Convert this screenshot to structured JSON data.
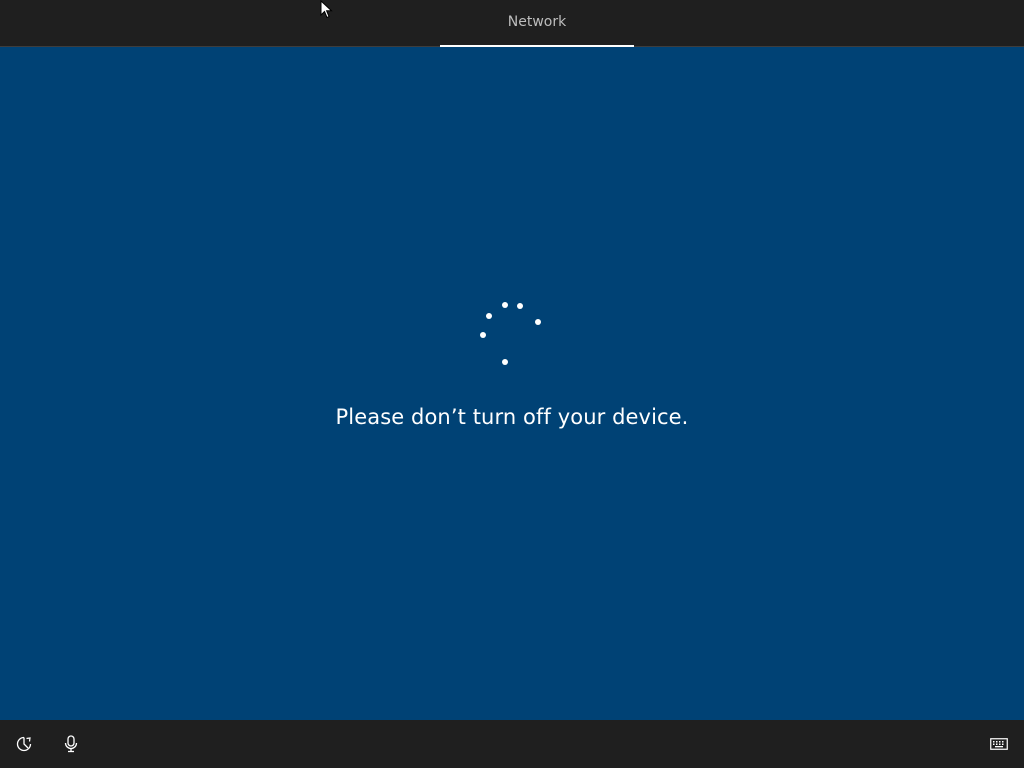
{
  "header": {
    "tab_label": "Network"
  },
  "main": {
    "status_message": "Please don’t turn off your device."
  },
  "footer": {
    "left_icons": [
      "ease-of-access-icon",
      "microphone-icon"
    ],
    "right_icons": [
      "keyboard-icon"
    ]
  },
  "colors": {
    "background": "#004275",
    "bars": "#1f1f1f",
    "text": "#ffffff",
    "tab_text": "#bdbdbd"
  }
}
